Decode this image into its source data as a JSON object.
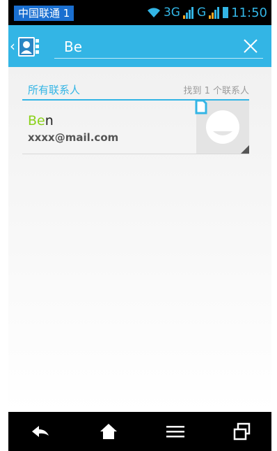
{
  "status_bar": {
    "carrier": "中国联通 1",
    "network": "3G",
    "network2": "G",
    "time": "11:50"
  },
  "search": {
    "query": "Be"
  },
  "section": {
    "title": "所有联系人",
    "result_count": "找到 1 个联系人"
  },
  "contacts": [
    {
      "name_highlight": "Be",
      "name_rest": "n",
      "email": "xxxx@mail.com"
    }
  ],
  "colors": {
    "accent": "#33b5e5",
    "highlight": "#8bd11a",
    "carrier_bg": "#1a6fd0"
  }
}
